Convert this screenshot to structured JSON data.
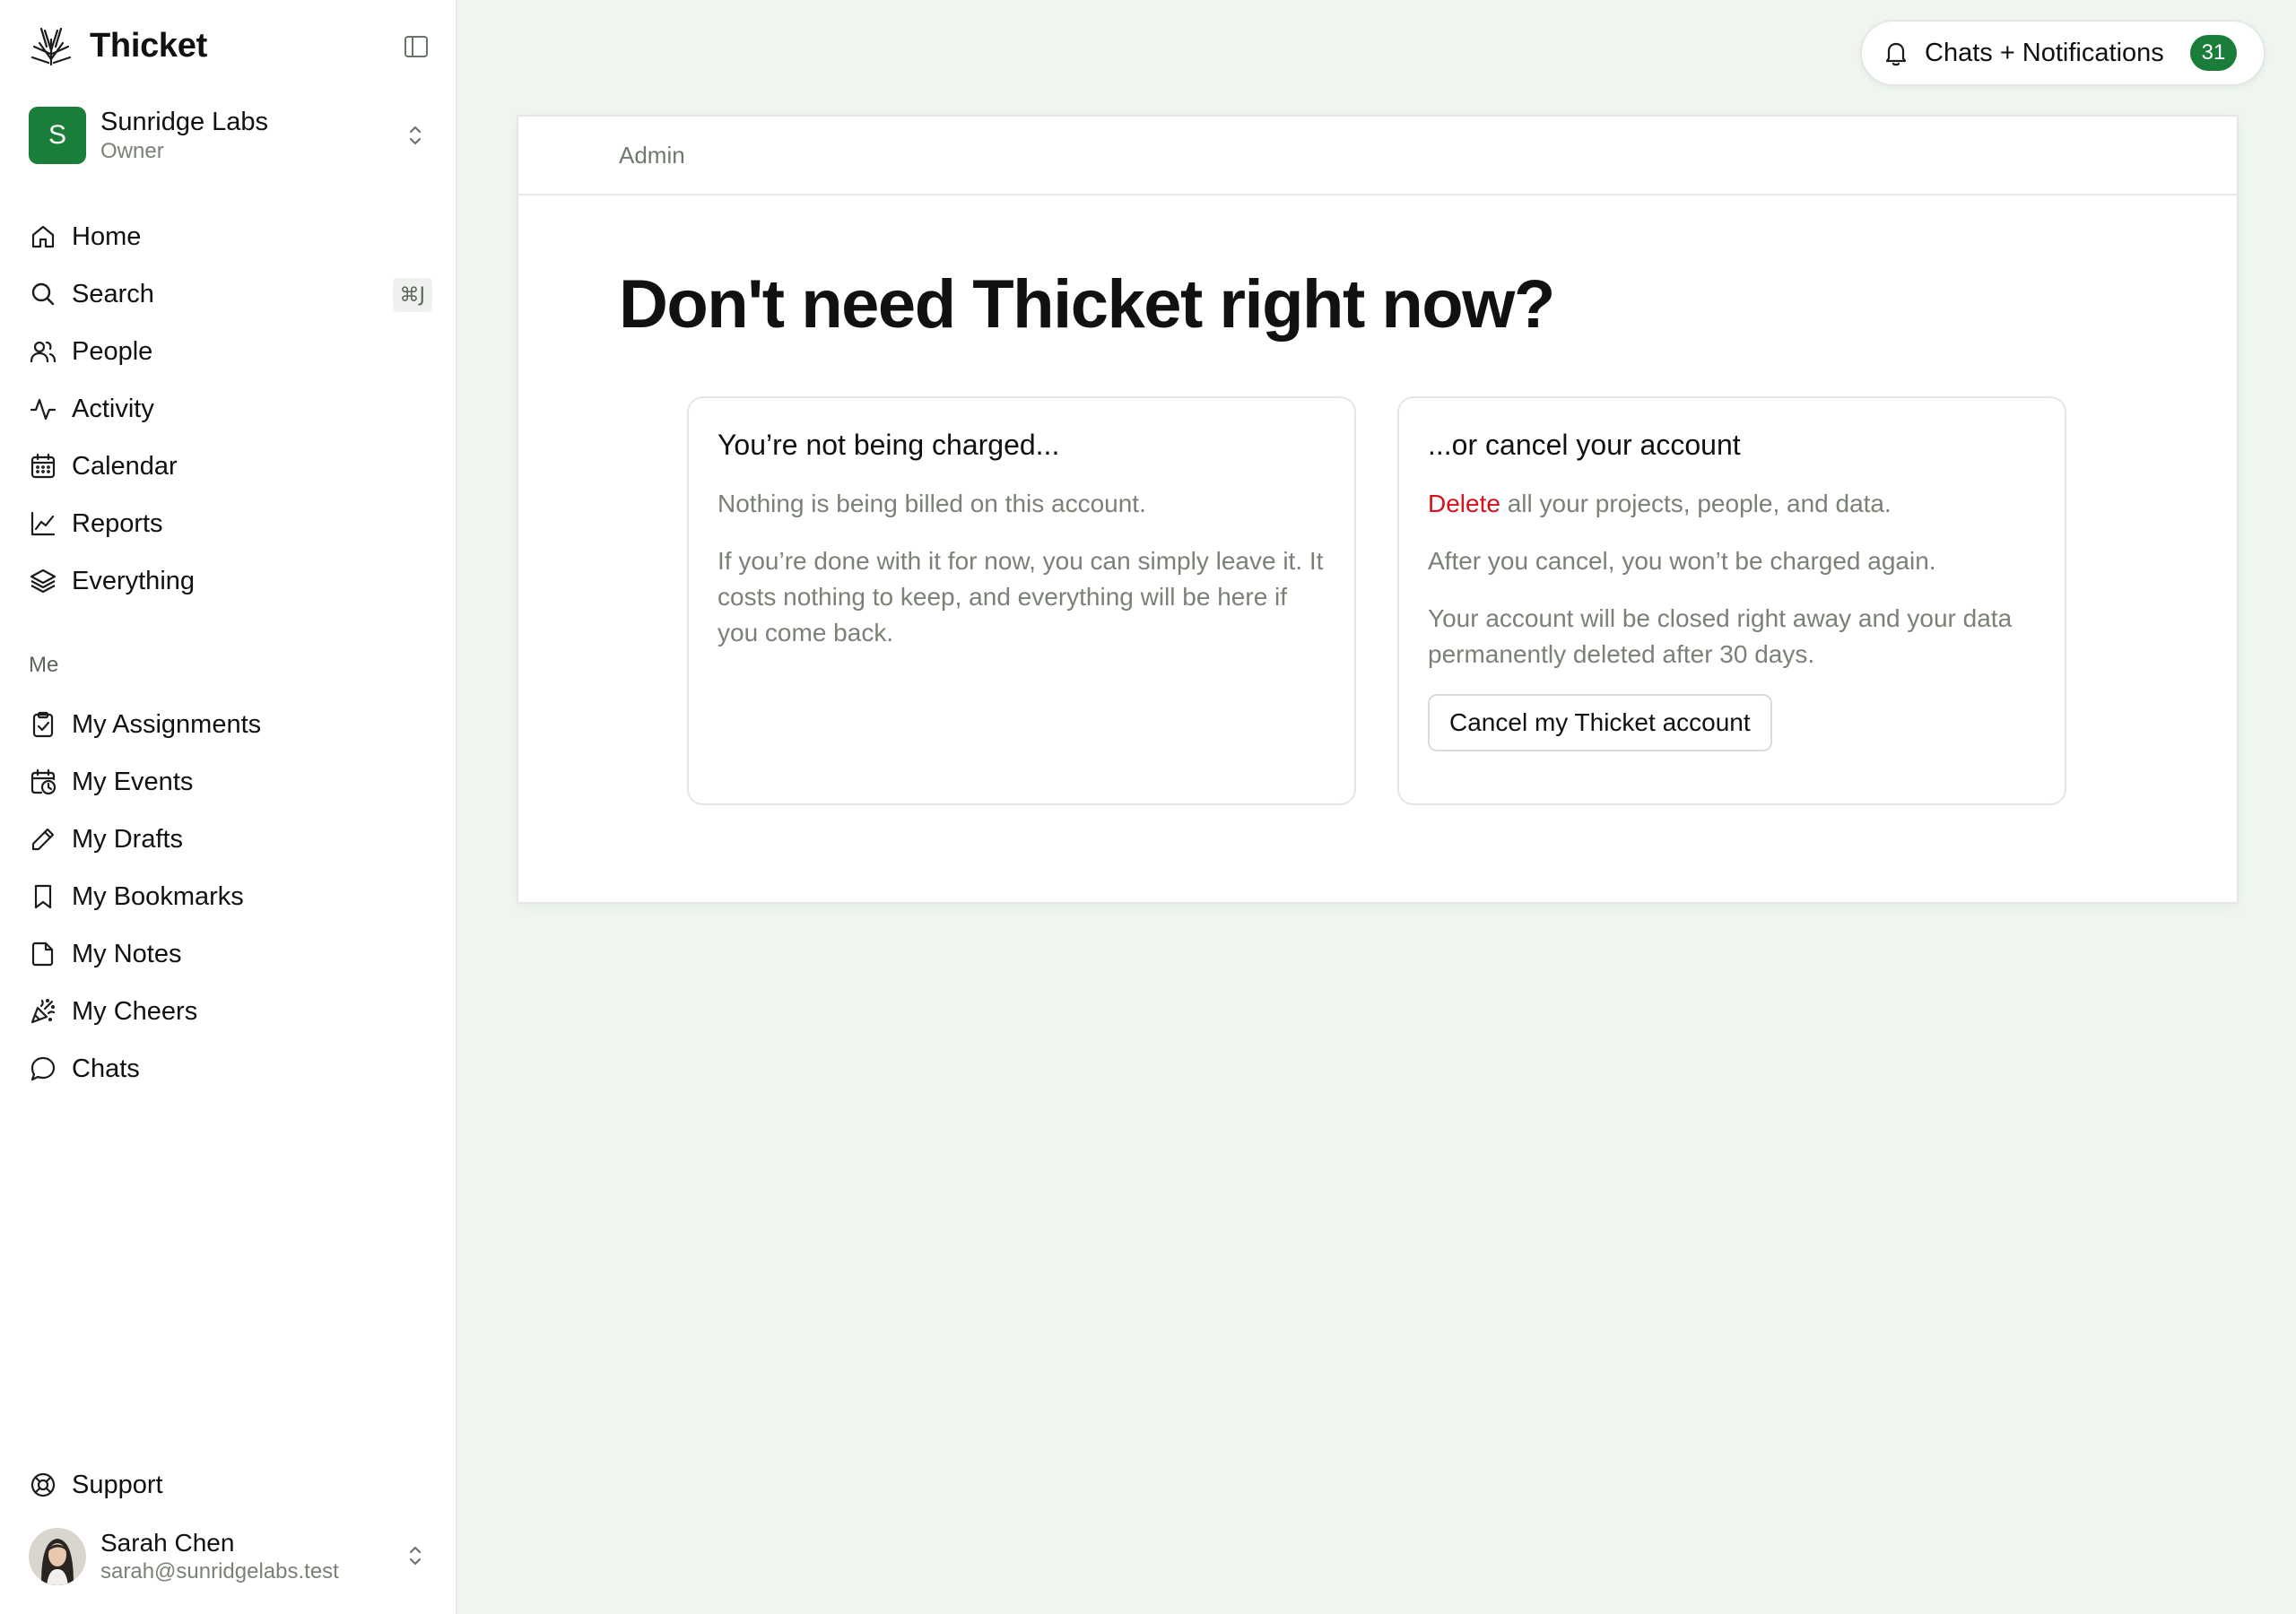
{
  "app": {
    "name": "Thicket"
  },
  "org": {
    "initial": "S",
    "name": "Sunridge Labs",
    "role": "Owner",
    "avatar_color": "#1a7d3a"
  },
  "nav": {
    "main": [
      {
        "label": "Home",
        "icon": "home-icon"
      },
      {
        "label": "Search",
        "icon": "search-icon",
        "shortcut": "⌘J"
      },
      {
        "label": "People",
        "icon": "people-icon"
      },
      {
        "label": "Activity",
        "icon": "activity-icon"
      },
      {
        "label": "Calendar",
        "icon": "calendar-icon"
      },
      {
        "label": "Reports",
        "icon": "chart-icon"
      },
      {
        "label": "Everything",
        "icon": "layers-icon"
      }
    ],
    "me_label": "Me",
    "me": [
      {
        "label": "My Assignments",
        "icon": "clipboard-check-icon"
      },
      {
        "label": "My Events",
        "icon": "calendar-clock-icon"
      },
      {
        "label": "My Drafts",
        "icon": "pencil-icon"
      },
      {
        "label": "My Bookmarks",
        "icon": "bookmark-icon"
      },
      {
        "label": "My Notes",
        "icon": "note-icon"
      },
      {
        "label": "My Cheers",
        "icon": "party-popper-icon"
      },
      {
        "label": "Chats",
        "icon": "chat-bubble-icon"
      }
    ],
    "support": {
      "label": "Support",
      "icon": "lifebuoy-icon"
    }
  },
  "user": {
    "name": "Sarah Chen",
    "email": "sarah@sunridgelabs.test"
  },
  "notifications": {
    "label": "Chats + Notifications",
    "count": "31"
  },
  "page": {
    "breadcrumb": "Admin",
    "title": "Don't need Thicket right now?",
    "left_card": {
      "title": "You’re not being charged...",
      "p1": "Nothing is being billed on this account.",
      "p2": "If you’re done with it for now, you can simply leave it. It costs nothing to keep, and everything will be here if you come back."
    },
    "right_card": {
      "title": "...or cancel your account",
      "delete_word": "Delete",
      "p1_rest": " all your projects, people, and data.",
      "p2": "After you cancel, you won’t be charged again.",
      "p3": "Your account will be closed right away and your data permanently deleted after 30 days.",
      "button": "Cancel my Thicket account"
    }
  },
  "colors": {
    "accent": "#1a7d3a",
    "danger": "#d4121c",
    "background": "#eef6ef"
  }
}
